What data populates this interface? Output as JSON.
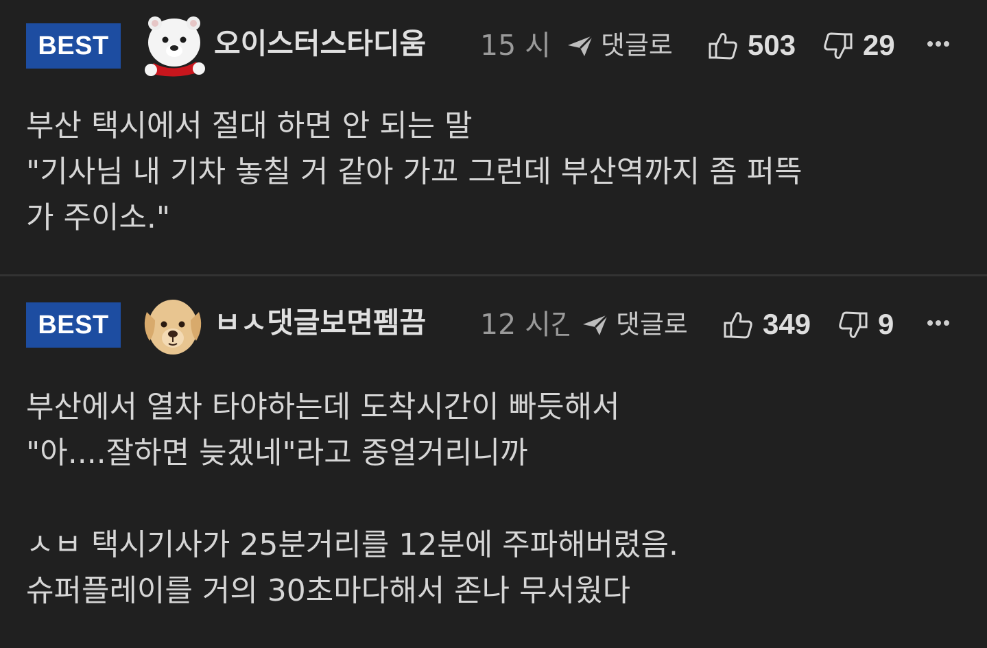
{
  "comments": [
    {
      "badge": "BEST",
      "username": "오이스터스타디움",
      "avatar": "polar-bear-avatar",
      "time": "15 시",
      "reply_label": "댓글로",
      "upvotes": "503",
      "downvotes": "29",
      "lines": [
        "부산 택시에서 절대 하면 안 되는 말",
        "\"기사님 내 기차 놓칠 거 같아 가꼬 그런데 부산역까지 좀 퍼뜩",
        "가 주이소.\""
      ]
    },
    {
      "badge": "BEST",
      "username": "ㅂㅅ댓글보면펨끔",
      "avatar": "puppy-avatar",
      "time": "12 시간",
      "reply_label": "댓글로",
      "upvotes": "349",
      "downvotes": "9",
      "lines": [
        "부산에서 열차 타야하는데 도착시간이 빠듯해서",
        "\"아....잘하면 늦겠네\"라고 중얼거리니까",
        "",
        "ㅅㅂ 택시기사가 25분거리를 12분에 주파해버렸음.",
        "슈퍼플레이를 거의 30초마다해서 존나 무서웠다"
      ]
    }
  ],
  "colors": {
    "background": "#202020",
    "badge": "#1d4da1",
    "divider": "#333333"
  },
  "icons": [
    "polar-bear-avatar",
    "puppy-avatar",
    "reply-arrow-icon",
    "thumbs-up-icon",
    "thumbs-down-icon",
    "more-icon"
  ]
}
